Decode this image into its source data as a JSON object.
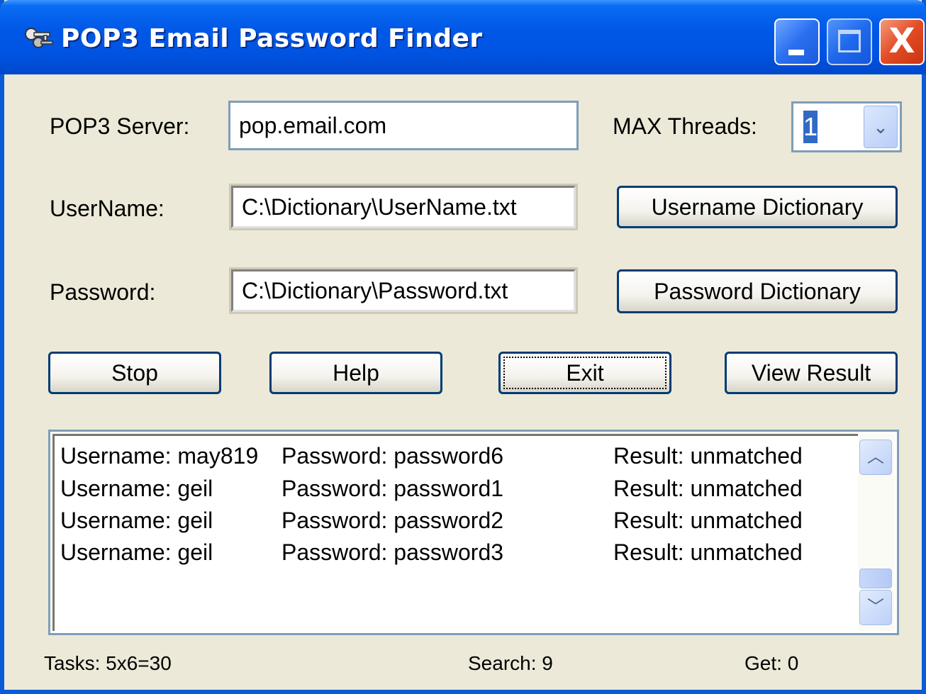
{
  "window": {
    "title": "POP3 Email Password Finder",
    "icon": "keys-icon",
    "controls": {
      "minimize": "minimize-icon",
      "maximize": "maximize-icon",
      "close": "close-icon",
      "close_glyph": "X"
    }
  },
  "form": {
    "server_label": "POP3 Server:",
    "server_value": "pop.email.com",
    "threads_label": "MAX Threads:",
    "threads_value": "1",
    "threads_arrow": "⌄",
    "username_label": "UserName:",
    "username_value": "C:\\Dictionary\\UserName.txt",
    "username_button": "Username Dictionary",
    "password_label": "Password:",
    "password_value": "C:\\Dictionary\\Password.txt",
    "password_button": "Password Dictionary"
  },
  "actions": {
    "stop": "Stop",
    "help": "Help",
    "exit": "Exit",
    "view_result": "View Result"
  },
  "results": [
    {
      "username": "Username: may819",
      "password": "Password: password6",
      "result": "Result: unmatched"
    },
    {
      "username": "Username: geil",
      "password": "Password: password1",
      "result": "Result: unmatched"
    },
    {
      "username": "Username: geil",
      "password": "Password: password2",
      "result": "Result: unmatched"
    },
    {
      "username": "Username: geil",
      "password": "Password: password3",
      "result": "Result: unmatched"
    }
  ],
  "scroll": {
    "up": "︿",
    "down": "﹀"
  },
  "status": {
    "tasks": "Tasks:  5x6=30",
    "search": "Search:  9",
    "get": "Get:  0"
  },
  "colors": {
    "titlebar": "#0054e3",
    "window_bg": "#ece9d8",
    "field_border": "#7f9db9",
    "button_border": "#003c74",
    "selection": "#316ac5"
  }
}
